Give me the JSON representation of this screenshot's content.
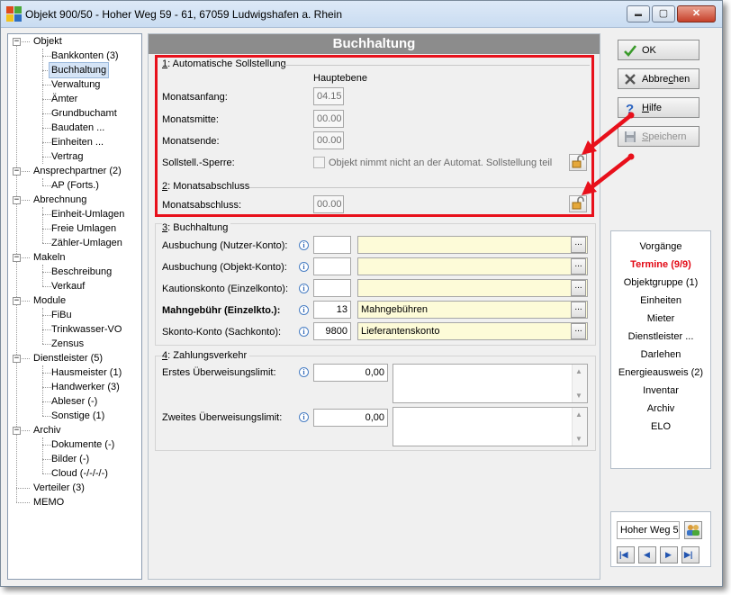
{
  "window": {
    "title": "Objekt 900/50 - Hoher Weg 59 - 61, 67059 Ludwigshafen a. Rhein",
    "minimize_glyph": "▬",
    "maximize_glyph": "▢",
    "close_glyph": "✕"
  },
  "tree": {
    "items": [
      {
        "label": "Objekt"
      },
      {
        "label": "Bankkonten (3)"
      },
      {
        "label": "Buchhaltung"
      },
      {
        "label": "Verwaltung"
      },
      {
        "label": "Ämter"
      },
      {
        "label": "Grundbuchamt"
      },
      {
        "label": "Baudaten ..."
      },
      {
        "label": "Einheiten ..."
      },
      {
        "label": "Vertrag"
      },
      {
        "label": "Ansprechpartner (2)"
      },
      {
        "label": "AP (Forts.)"
      },
      {
        "label": "Abrechnung"
      },
      {
        "label": "Einheit-Umlagen"
      },
      {
        "label": "Freie Umlagen"
      },
      {
        "label": "Zähler-Umlagen"
      },
      {
        "label": "Makeln"
      },
      {
        "label": "Beschreibung"
      },
      {
        "label": "Verkauf"
      },
      {
        "label": "Module"
      },
      {
        "label": "FiBu"
      },
      {
        "label": "Trinkwasser-VO"
      },
      {
        "label": "Zensus"
      },
      {
        "label": "Dienstleister (5)"
      },
      {
        "label": "Hausmeister (1)"
      },
      {
        "label": "Handwerker (3)"
      },
      {
        "label": "Ableser (-)"
      },
      {
        "label": "Sonstige (1)"
      },
      {
        "label": "Archiv"
      },
      {
        "label": "Dokumente (-)"
      },
      {
        "label": "Bilder (-)"
      },
      {
        "label": "Cloud (-/-/-/-)"
      },
      {
        "label": "Verteiler (3)"
      },
      {
        "label": "MEMO"
      }
    ],
    "expander_glyph": "−"
  },
  "main": {
    "header": "Buchhaltung",
    "sollstellung": {
      "title_key": "1",
      "title_rest": ": Automatische Sollstellung",
      "column_header": "Hauptebene",
      "monatsanfang_label": "Monatsanfang:",
      "monatsanfang_value": "04.15",
      "monatsmitte_label": "Monatsmitte:",
      "monatsmitte_value": "00.00",
      "monatsende_label": "Monatsende:",
      "monatsende_value": "00.00",
      "sperre_label": "Sollstell.-Sperre:",
      "sperre_checkbox_label": "Objekt nimmt nicht an der Automat. Sollstellung teil"
    },
    "monatsabschluss": {
      "title_key": "2",
      "title_rest": ": Monatsabschluss",
      "label": "Monatsabschluss:",
      "value": "00.00"
    },
    "buchhaltung": {
      "title_key": "3",
      "title_rest": ": Buchhaltung",
      "info_glyph": "i",
      "dots_glyph": "...",
      "rows": [
        {
          "label": "Ausbuchung (Nutzer-Konto):",
          "number": "",
          "text": ""
        },
        {
          "label": "Ausbuchung (Objekt-Konto):",
          "number": "",
          "text": ""
        },
        {
          "label": "Kautionskonto (Einzelkonto):",
          "number": "",
          "text": ""
        },
        {
          "label": "Mahngebühr (Einzelkto.):",
          "number": "13",
          "text": "Mahngebühren"
        },
        {
          "label": "Skonto-Konto (Sachkonto):",
          "number": "9800",
          "text": "Lieferantenskonto"
        }
      ]
    },
    "zahlungsverkehr": {
      "title_key": "4",
      "title_rest": ": Zahlungsverkehr",
      "erstes_label": "Erstes Überweisungslimit:",
      "erstes_value": "0,00",
      "zweites_label": "Zweites Überweisungslimit:",
      "zweites_value": "0,00",
      "scroll_up_glyph": "▲",
      "scroll_down_glyph": "▼"
    }
  },
  "right": {
    "ok_label": "OK",
    "cancel_pre": "Abbre",
    "cancel_key": "c",
    "cancel_post": "hen",
    "help_key": "H",
    "help_post": "ilfe",
    "save_key": "S",
    "save_post": "peichern",
    "nav_items": [
      "Vorgänge",
      "Termine (9/9)",
      "Objektgruppe (1)",
      "Einheiten",
      "Mieter",
      "Dienstleister ...",
      "Darlehen",
      "Energieausweis (2)",
      "Inventar",
      "Archiv",
      "ELO"
    ],
    "active_index": 1,
    "search_value": "Hoher Weg 5",
    "nav_first_glyph": "|◀",
    "nav_prev_glyph": "◀",
    "nav_next_glyph": "▶",
    "nav_last_glyph": "▶|"
  },
  "colors": {
    "highlight": "#e8101b",
    "active_nav": "#e20a16",
    "header_bg": "#8c8c8c",
    "lookup_bg": "#fdfbd8"
  }
}
